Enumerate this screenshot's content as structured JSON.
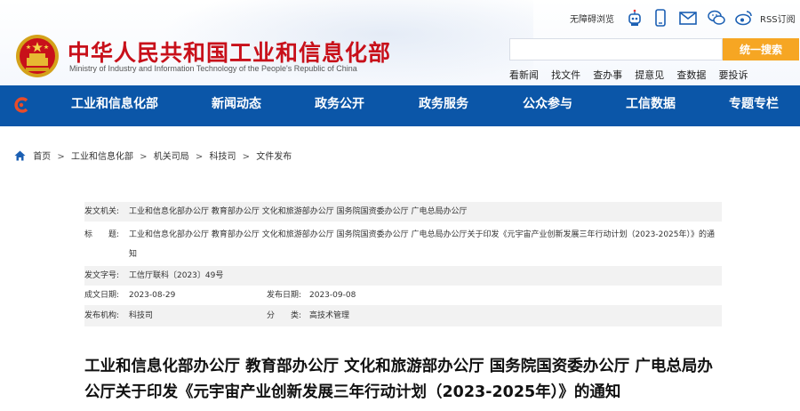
{
  "header": {
    "site_title": "中华人民共和国工业和信息化部",
    "site_subtitle": "Ministry of Industry and Information Technology of the People's Republic of China",
    "accessibility_label": "无障碍浏览",
    "rss_label": "RSS订阅",
    "search": {
      "value": "",
      "placeholder": "",
      "button_label": "统一搜索"
    },
    "quick_links": [
      "看新闻",
      "找文件",
      "查办事",
      "提意见",
      "查数据",
      "要投诉"
    ]
  },
  "nav": {
    "items": [
      "工业和信息化部",
      "新闻动态",
      "政务公开",
      "政务服务",
      "公众参与",
      "工信数据",
      "专题专栏"
    ]
  },
  "breadcrumb": [
    "首页",
    "工业和信息化部",
    "机关司局",
    "科技司",
    "文件发布"
  ],
  "info": {
    "issuer_label": "发文机关:",
    "issuer_value": "工业和信息化部办公厅 教育部办公厅 文化和旅游部办公厅 国务院国资委办公厅 广电总局办公厅",
    "title_label": "标　　题:",
    "title_value": "工业和信息化部办公厅 教育部办公厅 文化和旅游部办公厅 国务院国资委办公厅 广电总局办公厅关于印发《元宇宙产业创新发展三年行动计划（2023-2025年）》的通知",
    "doc_number_label": "发文字号:",
    "doc_number_value": "工信厅联科〔2023〕49号",
    "created_label": "成文日期:",
    "created_value": "2023-08-29",
    "published_label": "发布日期:",
    "published_value": "2023-09-08",
    "publisher_label": "发布机构:",
    "publisher_value": "科技司",
    "category_label": "分　　类:",
    "category_value": "高技术管理"
  },
  "article": {
    "title": "工业和信息化部办公厅 教育部办公厅 文化和旅游部办公厅 国务院国资委办公厅 广电总局办公厅关于印发《元宇宙产业创新发展三年行动计划（2023-2025年）》的通知"
  },
  "icons": [
    "emblem-icon",
    "robot-icon",
    "mobile-icon",
    "mail-icon",
    "wechat-icon",
    "weibo-icon",
    "rss-icon",
    "home-icon",
    "nav-logo-icon"
  ],
  "colors": {
    "brand_red": "#c8101a",
    "nav_blue": "#0b56a8",
    "search_orange": "#f6a623"
  }
}
